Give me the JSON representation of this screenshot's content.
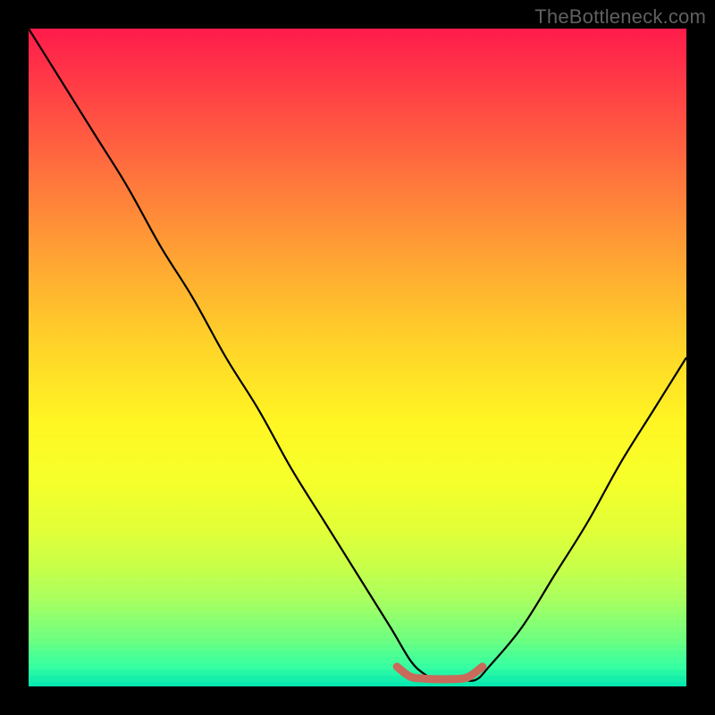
{
  "watermark": "TheBottleneck.com",
  "chart_data": {
    "type": "line",
    "title": "",
    "xlabel": "",
    "ylabel": "",
    "xlim": [
      0,
      100
    ],
    "ylim": [
      0,
      100
    ],
    "grid": false,
    "legend": false,
    "series": [
      {
        "name": "curve",
        "color": "#000000",
        "x": [
          0,
          5,
          10,
          15,
          20,
          25,
          30,
          35,
          40,
          45,
          50,
          55,
          58,
          60,
          62,
          64,
          66,
          68,
          70,
          75,
          80,
          85,
          90,
          95,
          100
        ],
        "values": [
          100,
          92,
          84,
          76,
          67,
          59,
          50,
          42,
          33,
          25,
          17,
          9,
          4,
          2,
          1,
          1,
          1,
          1,
          3,
          9,
          17,
          25,
          34,
          42,
          50
        ]
      },
      {
        "name": "highlight",
        "color": "#c96a5a",
        "x": [
          56,
          58,
          60,
          62,
          64,
          66,
          67,
          68,
          69
        ],
        "values": [
          3,
          1.5,
          1.2,
          1.1,
          1.1,
          1.2,
          1.5,
          2.2,
          3
        ]
      }
    ]
  }
}
